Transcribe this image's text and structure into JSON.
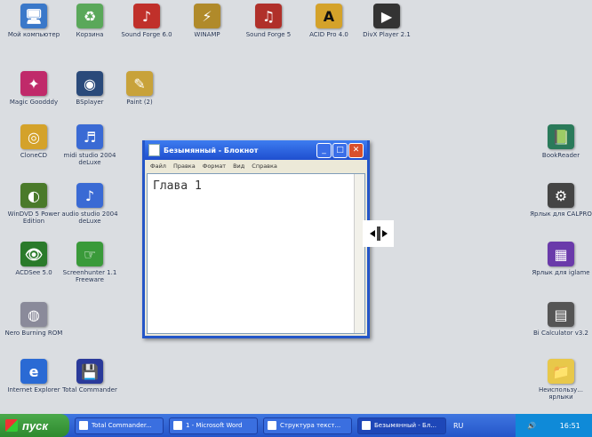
{
  "desktop_icons": [
    {
      "label": "Мой компьютер",
      "icon": "computer-icon",
      "color": "#3a78c9"
    },
    {
      "label": "Корзина",
      "icon": "recycle-bin-icon",
      "color": "#5aa85a"
    },
    {
      "label": "Sound Forge 6.0",
      "icon": "sound-forge-icon",
      "color": "#c0302a"
    },
    {
      "label": "WINAMP",
      "icon": "winamp-icon",
      "color": "#b08a2a"
    },
    {
      "label": "Sound Forge 5",
      "icon": "sound-forge-5-icon",
      "color": "#b0302a"
    },
    {
      "label": "ACID Pro 4.0",
      "icon": "acid-pro-icon",
      "color": "#d4a22a"
    },
    {
      "label": "DivX Player 2.1",
      "icon": "divx-player-icon",
      "color": "#333333"
    },
    {
      "label": "Magic Goodddy",
      "icon": "magic-goody-icon",
      "color": "#c02a6a"
    },
    {
      "label": "BSplayer",
      "icon": "bsplayer-icon",
      "color": "#2a4a7a"
    },
    {
      "label": "Paint (2)",
      "icon": "paint-icon",
      "color": "#c8a23a"
    },
    {
      "label": "CloneCD",
      "icon": "clonecd-icon",
      "color": "#d4a22a"
    },
    {
      "label": "midi studio 2004 deLuxe",
      "icon": "midi-studio-icon",
      "color": "#3a6ad4"
    },
    {
      "label": "WinDVD 5 Power Edition",
      "icon": "windvd-icon",
      "color": "#4a7a2a"
    },
    {
      "label": "audio studio 2004 deLuxe",
      "icon": "audio-studio-icon",
      "color": "#3a6ad4"
    },
    {
      "label": "ACDSee 5.0",
      "icon": "acdsee-icon",
      "color": "#2a7a2a"
    },
    {
      "label": "Screenhunter 1.1 Freeware",
      "icon": "screenhunter-icon",
      "color": "#3a9a3a"
    },
    {
      "label": "Nero Burning ROM",
      "icon": "nero-icon",
      "color": "#8a8a9a"
    },
    {
      "label": "Internet Explorer",
      "icon": "internet-explorer-icon",
      "color": "#2a6ad4"
    },
    {
      "label": "Total Commander",
      "icon": "total-commander-icon",
      "color": "#2a3a9a"
    },
    {
      "label": "BookReader",
      "icon": "bookreader-icon",
      "color": "#2a7a5a"
    },
    {
      "label": "Ярлык для CALPRO",
      "icon": "calpro-icon",
      "color": "#444444"
    },
    {
      "label": "Ярлык для iglame",
      "icon": "iglame-icon",
      "color": "#6a3aaa"
    },
    {
      "label": "Bi Calculator v3.2",
      "icon": "calculator-icon",
      "color": "#555555"
    },
    {
      "label": "Неиспользу... ярлыки",
      "icon": "folder-icon",
      "color": "#e8c84a"
    }
  ],
  "notepad": {
    "title": "Безымянный - Блокнот",
    "menu": [
      "Файл",
      "Правка",
      "Формат",
      "Вид",
      "Справка"
    ],
    "text": "Глава 1",
    "minimize": "_",
    "maximize": "□",
    "close": "✕"
  },
  "taskbar": {
    "start_label": "пуск",
    "buttons": [
      {
        "label": "Total Commander..."
      },
      {
        "label": "1 - Microsoft Word"
      },
      {
        "label": "Структура текст..."
      },
      {
        "label": "Безымянный - Бл..."
      }
    ],
    "language": "RU",
    "clock": "16:51"
  }
}
